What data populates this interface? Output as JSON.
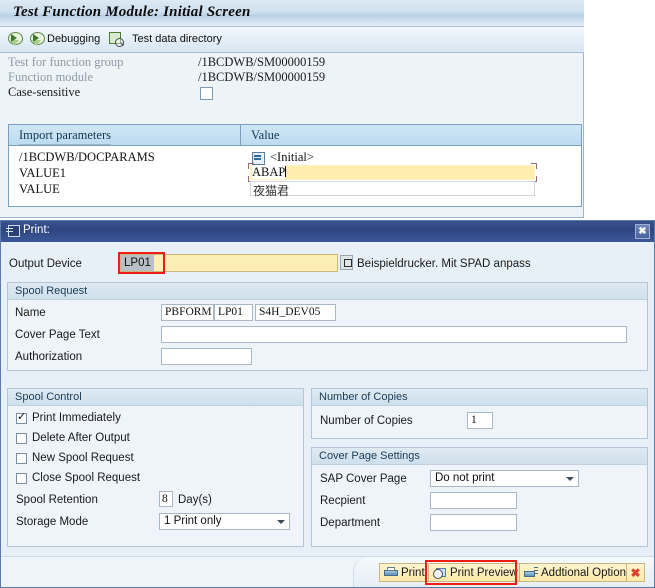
{
  "sap_screen": {
    "title": "Test Function Module: Initial Screen",
    "toolbar": {
      "execute_icon": "execute-debug-icon",
      "debugging_icon": "debug-icon",
      "debugging_label": "Debugging",
      "test_data_icon": "test-data-directory-icon",
      "test_data_label": "Test data directory"
    },
    "fields": [
      {
        "label": "Test for function group",
        "value": "/1BCDWB/SM00000159"
      },
      {
        "label": "Function module",
        "value": "/1BCDWB/SM00000159"
      },
      {
        "label": "Case-sensitive",
        "value": ""
      }
    ],
    "params_table": {
      "headers": [
        "Import parameters",
        "Value"
      ],
      "rows": [
        {
          "name": "/1BCDWB/DOCPARAMS",
          "value": "<Initial>",
          "icon": "structure-icon"
        },
        {
          "name": "VALUE1",
          "value": "ABAP"
        },
        {
          "name": "VALUE",
          "value": "夜猫君"
        }
      ]
    }
  },
  "print_dialog": {
    "title": "Print:",
    "close_label": "✖",
    "output_device": {
      "label": "Output Device",
      "value": "LP01",
      "description": "Beispieldrucker. Mit SPAD anpass",
      "highlighted": true
    },
    "spool_request": {
      "group_title": "Spool Request",
      "name_label": "Name",
      "name_parts": [
        "PBFORM",
        "LP01",
        "S4H_DEV05"
      ],
      "cover_page_text_label": "Cover Page Text",
      "cover_page_text_value": "",
      "authorization_label": "Authorization",
      "authorization_value": ""
    },
    "spool_control": {
      "group_title": "Spool Control",
      "checkboxes": [
        {
          "label": "Print Immediately",
          "checked": true
        },
        {
          "label": "Delete After Output",
          "checked": false
        },
        {
          "label": "New Spool Request",
          "checked": false
        },
        {
          "label": "Close Spool Request",
          "checked": false
        }
      ],
      "retention_label": "Spool Retention",
      "retention_value": "8",
      "retention_unit": "Day(s)",
      "storage_mode_label": "Storage Mode",
      "storage_mode_value": "1 Print only"
    },
    "number_of_copies": {
      "group_title": "Number of Copies",
      "label": "Number of Copies",
      "value": "1"
    },
    "cover_page_settings": {
      "group_title": "Cover Page Settings",
      "sap_cover_page_label": "SAP Cover Page",
      "sap_cover_page_value": "Do not print",
      "recipient_label": "Recpient",
      "recipient_value": "",
      "department_label": "Department",
      "department_value": ""
    },
    "buttons": {
      "print": "Print",
      "print_preview": "Print Preview",
      "additional_options": "Addtional Options",
      "cancel": "✖"
    }
  },
  "colors": {
    "highlight_red": "#ee1c17",
    "input_yellow": "#fdeeb5",
    "dialog_blue": "#2e4580",
    "panel_bg": "#eef4f9"
  }
}
